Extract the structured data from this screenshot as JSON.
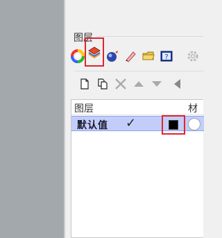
{
  "panel": {
    "title": "图层"
  },
  "tabs": [
    {
      "name": "color-wheel-icon",
      "selected": false
    },
    {
      "name": "layers-icon",
      "selected": true
    },
    {
      "name": "render-sphere-icon",
      "selected": false
    },
    {
      "name": "brush-icon",
      "selected": false
    },
    {
      "name": "folder-icon",
      "selected": false
    },
    {
      "name": "help-icon",
      "selected": false
    },
    {
      "name": "gear-icon",
      "selected": false
    }
  ],
  "toolbar": {
    "icons": [
      "new-layer-icon",
      "new-sublayer-icon",
      "delete-icon",
      "move-up-icon",
      "move-down-icon",
      "collapse-left-icon"
    ]
  },
  "list": {
    "col_layer": "图层",
    "col_material": "材",
    "rows": [
      {
        "name": "默认值",
        "current": "✓",
        "color": "#000000"
      }
    ]
  },
  "colors": {
    "selection_bg": "#c3cdfa",
    "highlight_box": "#e0252d"
  }
}
